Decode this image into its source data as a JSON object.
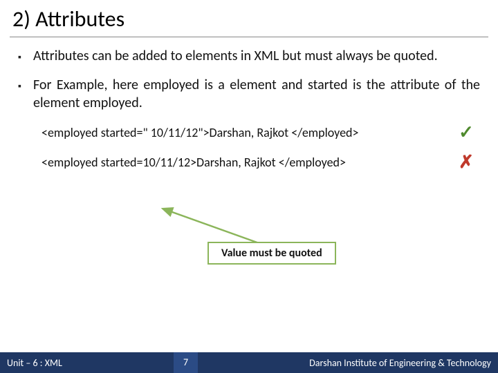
{
  "title": "2) Attributes",
  "bullets": [
    "Attributes can be added to elements in XML but must always be quoted.",
    "For Example, here employed is a element and started is the attribute of the element employed."
  ],
  "examples": {
    "correct": "<employed started=\" 10/11/12\">Darshan, Rajkot </employed>",
    "wrong": "<employed started=10/11/12>Darshan, Rajkot </employed>"
  },
  "callout": "Value must be quoted",
  "footer": {
    "unit": "Unit – 6 : XML",
    "page": "7",
    "institute": "Darshan Institute of Engineering & Technology"
  }
}
